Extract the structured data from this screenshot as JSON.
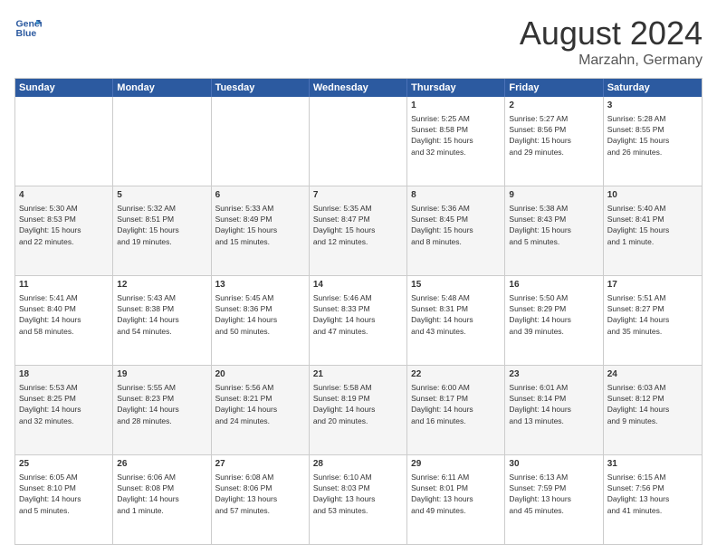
{
  "logo": {
    "line1": "General",
    "line2": "Blue"
  },
  "title": "August 2024",
  "location": "Marzahn, Germany",
  "header_days": [
    "Sunday",
    "Monday",
    "Tuesday",
    "Wednesday",
    "Thursday",
    "Friday",
    "Saturday"
  ],
  "rows": [
    {
      "alt": false,
      "cells": [
        {
          "day": "",
          "text": ""
        },
        {
          "day": "",
          "text": ""
        },
        {
          "day": "",
          "text": ""
        },
        {
          "day": "",
          "text": ""
        },
        {
          "day": "1",
          "text": "Sunrise: 5:25 AM\nSunset: 8:58 PM\nDaylight: 15 hours\nand 32 minutes."
        },
        {
          "day": "2",
          "text": "Sunrise: 5:27 AM\nSunset: 8:56 PM\nDaylight: 15 hours\nand 29 minutes."
        },
        {
          "day": "3",
          "text": "Sunrise: 5:28 AM\nSunset: 8:55 PM\nDaylight: 15 hours\nand 26 minutes."
        }
      ]
    },
    {
      "alt": true,
      "cells": [
        {
          "day": "4",
          "text": "Sunrise: 5:30 AM\nSunset: 8:53 PM\nDaylight: 15 hours\nand 22 minutes."
        },
        {
          "day": "5",
          "text": "Sunrise: 5:32 AM\nSunset: 8:51 PM\nDaylight: 15 hours\nand 19 minutes."
        },
        {
          "day": "6",
          "text": "Sunrise: 5:33 AM\nSunset: 8:49 PM\nDaylight: 15 hours\nand 15 minutes."
        },
        {
          "day": "7",
          "text": "Sunrise: 5:35 AM\nSunset: 8:47 PM\nDaylight: 15 hours\nand 12 minutes."
        },
        {
          "day": "8",
          "text": "Sunrise: 5:36 AM\nSunset: 8:45 PM\nDaylight: 15 hours\nand 8 minutes."
        },
        {
          "day": "9",
          "text": "Sunrise: 5:38 AM\nSunset: 8:43 PM\nDaylight: 15 hours\nand 5 minutes."
        },
        {
          "day": "10",
          "text": "Sunrise: 5:40 AM\nSunset: 8:41 PM\nDaylight: 15 hours\nand 1 minute."
        }
      ]
    },
    {
      "alt": false,
      "cells": [
        {
          "day": "11",
          "text": "Sunrise: 5:41 AM\nSunset: 8:40 PM\nDaylight: 14 hours\nand 58 minutes."
        },
        {
          "day": "12",
          "text": "Sunrise: 5:43 AM\nSunset: 8:38 PM\nDaylight: 14 hours\nand 54 minutes."
        },
        {
          "day": "13",
          "text": "Sunrise: 5:45 AM\nSunset: 8:36 PM\nDaylight: 14 hours\nand 50 minutes."
        },
        {
          "day": "14",
          "text": "Sunrise: 5:46 AM\nSunset: 8:33 PM\nDaylight: 14 hours\nand 47 minutes."
        },
        {
          "day": "15",
          "text": "Sunrise: 5:48 AM\nSunset: 8:31 PM\nDaylight: 14 hours\nand 43 minutes."
        },
        {
          "day": "16",
          "text": "Sunrise: 5:50 AM\nSunset: 8:29 PM\nDaylight: 14 hours\nand 39 minutes."
        },
        {
          "day": "17",
          "text": "Sunrise: 5:51 AM\nSunset: 8:27 PM\nDaylight: 14 hours\nand 35 minutes."
        }
      ]
    },
    {
      "alt": true,
      "cells": [
        {
          "day": "18",
          "text": "Sunrise: 5:53 AM\nSunset: 8:25 PM\nDaylight: 14 hours\nand 32 minutes."
        },
        {
          "day": "19",
          "text": "Sunrise: 5:55 AM\nSunset: 8:23 PM\nDaylight: 14 hours\nand 28 minutes."
        },
        {
          "day": "20",
          "text": "Sunrise: 5:56 AM\nSunset: 8:21 PM\nDaylight: 14 hours\nand 24 minutes."
        },
        {
          "day": "21",
          "text": "Sunrise: 5:58 AM\nSunset: 8:19 PM\nDaylight: 14 hours\nand 20 minutes."
        },
        {
          "day": "22",
          "text": "Sunrise: 6:00 AM\nSunset: 8:17 PM\nDaylight: 14 hours\nand 16 minutes."
        },
        {
          "day": "23",
          "text": "Sunrise: 6:01 AM\nSunset: 8:14 PM\nDaylight: 14 hours\nand 13 minutes."
        },
        {
          "day": "24",
          "text": "Sunrise: 6:03 AM\nSunset: 8:12 PM\nDaylight: 14 hours\nand 9 minutes."
        }
      ]
    },
    {
      "alt": false,
      "cells": [
        {
          "day": "25",
          "text": "Sunrise: 6:05 AM\nSunset: 8:10 PM\nDaylight: 14 hours\nand 5 minutes."
        },
        {
          "day": "26",
          "text": "Sunrise: 6:06 AM\nSunset: 8:08 PM\nDaylight: 14 hours\nand 1 minute."
        },
        {
          "day": "27",
          "text": "Sunrise: 6:08 AM\nSunset: 8:06 PM\nDaylight: 13 hours\nand 57 minutes."
        },
        {
          "day": "28",
          "text": "Sunrise: 6:10 AM\nSunset: 8:03 PM\nDaylight: 13 hours\nand 53 minutes."
        },
        {
          "day": "29",
          "text": "Sunrise: 6:11 AM\nSunset: 8:01 PM\nDaylight: 13 hours\nand 49 minutes."
        },
        {
          "day": "30",
          "text": "Sunrise: 6:13 AM\nSunset: 7:59 PM\nDaylight: 13 hours\nand 45 minutes."
        },
        {
          "day": "31",
          "text": "Sunrise: 6:15 AM\nSunset: 7:56 PM\nDaylight: 13 hours\nand 41 minutes."
        }
      ]
    }
  ]
}
